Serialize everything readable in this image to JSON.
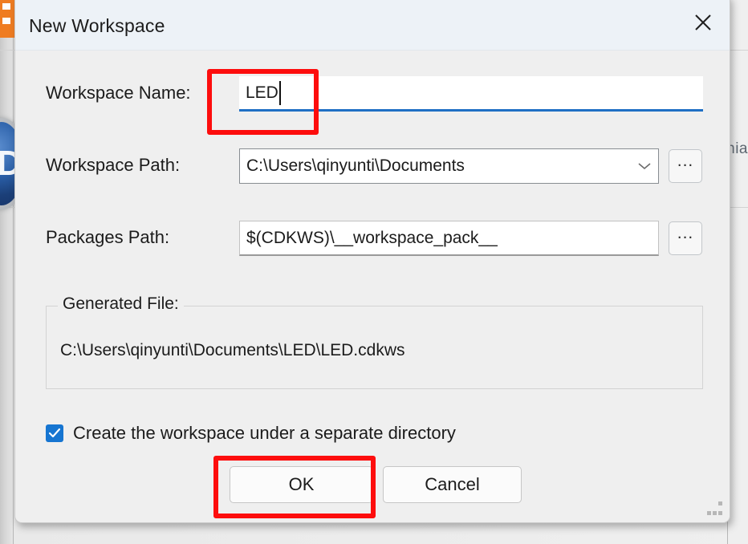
{
  "background": {
    "logo_letter": "D",
    "right_text": "hia",
    "toolbar_icon_name": "orange-toolbar-icon"
  },
  "dialog": {
    "title": "New Workspace",
    "close_icon": "close-icon",
    "resize_grip_name": "resize-grip"
  },
  "form": {
    "workspace_name": {
      "label": "Workspace Name:",
      "value": "LED",
      "placeholder": "",
      "focused": true
    },
    "workspace_path": {
      "label": "Workspace Path:",
      "value": "C:\\Users\\qinyunti\\Documents",
      "dropdown_icon": "chevron-down-icon",
      "browse_label": "..."
    },
    "packages_path": {
      "label": "Packages Path:",
      "value": "$(CDKWS)\\__workspace_pack__",
      "browse_label": "..."
    }
  },
  "generated_file": {
    "legend": "Generated File:",
    "path": "C:\\Users\\qinyunti\\Documents\\LED\\LED.cdkws"
  },
  "options": {
    "separate_directory": {
      "label": "Create the workspace under a separate directory",
      "checked": true,
      "check_icon": "checkmark-icon"
    }
  },
  "buttons": {
    "ok": "OK",
    "cancel": "Cancel"
  },
  "colors": {
    "accent_blue": "#1675d1",
    "focus_underline": "#1f6fc4",
    "annotation_red": "#fd0d0d",
    "title_bar": "#edf2f7",
    "dialog_bg": "#efefef",
    "brand_orange": "#ef7c21"
  }
}
